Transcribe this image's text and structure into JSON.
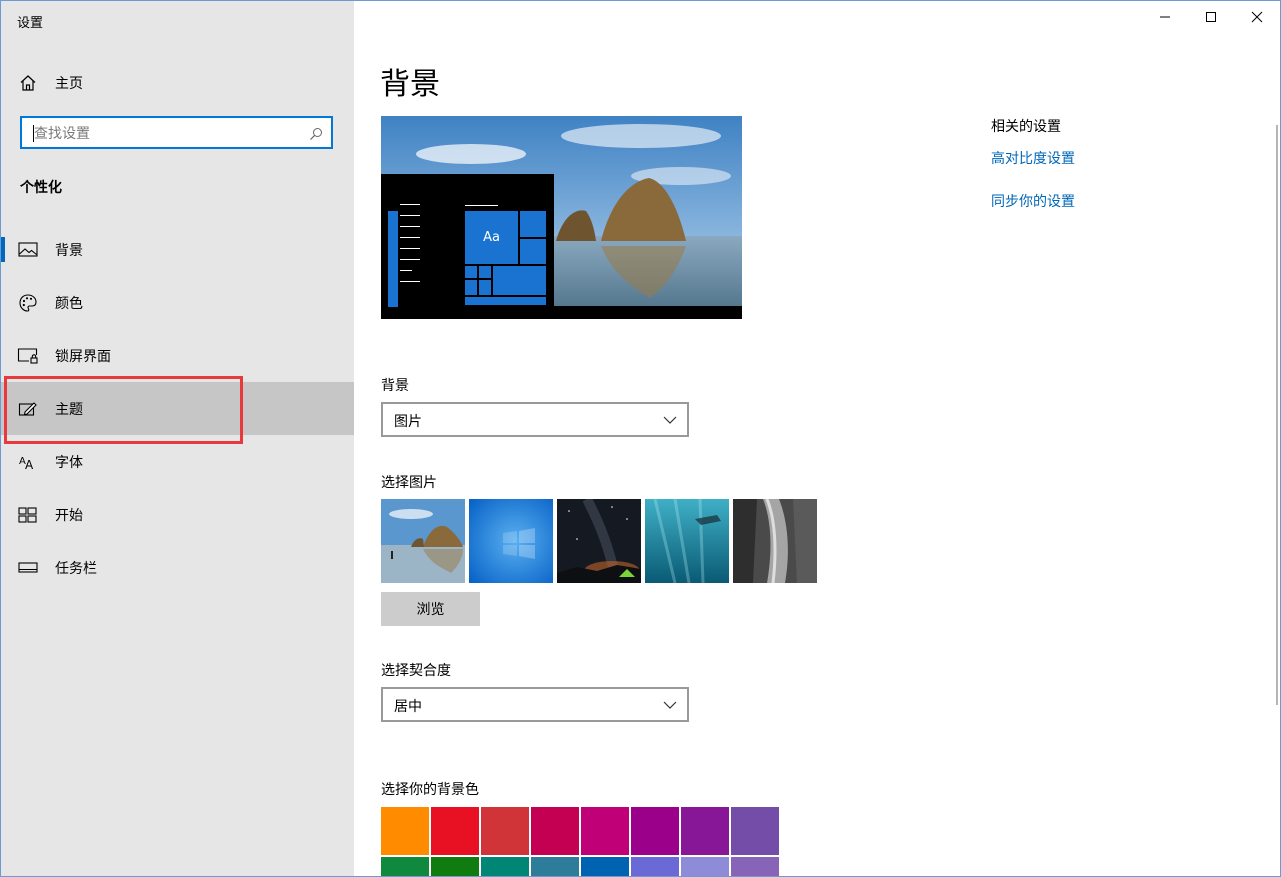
{
  "app": {
    "title": "设置"
  },
  "sidebar": {
    "home_label": "主页",
    "search_placeholder": "查找设置",
    "section_title": "个性化",
    "items": [
      {
        "label": "背景",
        "icon": "picture-icon"
      },
      {
        "label": "颜色",
        "icon": "palette-icon"
      },
      {
        "label": "锁屏界面",
        "icon": "lock-screen-icon"
      },
      {
        "label": "主题",
        "icon": "theme-icon"
      },
      {
        "label": "字体",
        "icon": "font-icon"
      },
      {
        "label": "开始",
        "icon": "start-icon"
      },
      {
        "label": "任务栏",
        "icon": "taskbar-icon"
      }
    ]
  },
  "main": {
    "page_title": "背景",
    "preview": {
      "tile_text": "Aa"
    },
    "background": {
      "label": "背景",
      "value": "图片"
    },
    "choose_picture": {
      "label": "选择图片",
      "browse_label": "浏览"
    },
    "fit": {
      "label": "选择契合度",
      "value": "居中"
    },
    "bg_color": {
      "label": "选择你的背景色",
      "colors_row1": [
        "#ff8c00",
        "#e81123",
        "#d13438",
        "#c30052",
        "#bf0077",
        "#9a0089",
        "#881798",
        "#744da9"
      ],
      "colors_row2": [
        "#10893e",
        "#107c10",
        "#018574",
        "#2d7d9a",
        "#0063b1",
        "#6b69d6",
        "#8e8cd8",
        "#8764b8"
      ]
    }
  },
  "related": {
    "heading": "相关的设置",
    "links": [
      "高对比度设置",
      "同步你的设置"
    ]
  },
  "colors": {
    "accent": "#0078d7",
    "link": "#0067b8",
    "highlight_frame": "#e8393d"
  }
}
